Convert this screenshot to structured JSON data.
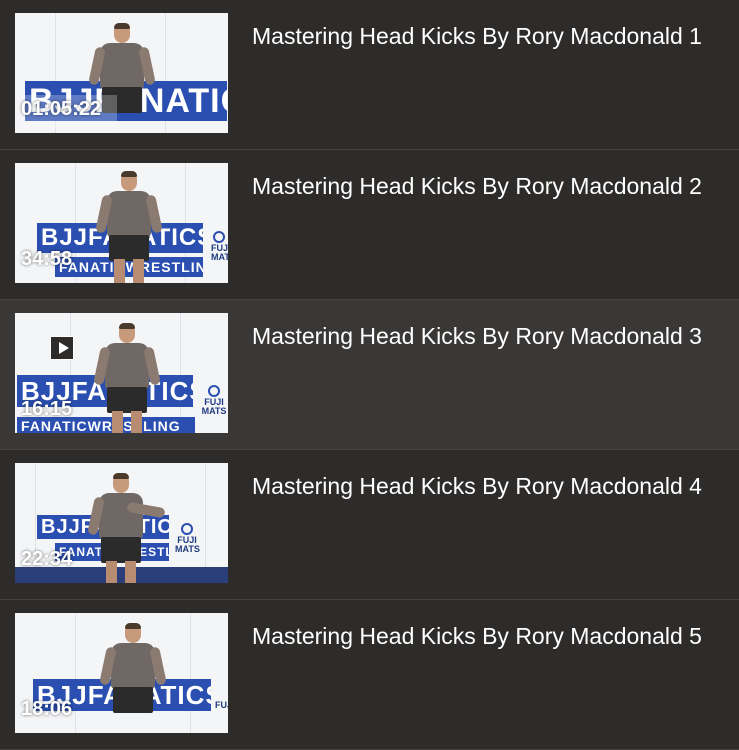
{
  "playlist": {
    "items": [
      {
        "title": "Mastering Head Kicks By Rory Macdonald 1",
        "duration": "01:05:22",
        "banner": "BJJFANATICS",
        "active": false,
        "playing": false
      },
      {
        "title": "Mastering Head Kicks By Rory Macdonald 2",
        "duration": "34:58",
        "banner": "BJJFANATICS",
        "banner2": "FANATICWRESTLING",
        "fuji": "FUJI MATS",
        "active": false,
        "playing": false
      },
      {
        "title": "Mastering Head Kicks By Rory Macdonald 3",
        "duration": "16:15",
        "banner": "BJJFANATICS",
        "banner2": "FANATICWRESTLING",
        "fuji": "FUJI MATS",
        "active": true,
        "playing": true
      },
      {
        "title": "Mastering Head Kicks By Rory Macdonald 4",
        "duration": "22:34",
        "banner": "BJJFANATICS",
        "banner2": "FANATICWRESTLING",
        "fuji": "FUJI MATS",
        "active": false,
        "playing": false
      },
      {
        "title": "Mastering Head Kicks By Rory Macdonald 5",
        "duration": "18:06",
        "banner": "BJJFANATICS",
        "fuji": "FUJI",
        "active": false,
        "playing": false
      }
    ]
  },
  "colors": {
    "background": "#2e2c2b",
    "active_row": "#3a3837",
    "banner_blue": "#2a4fb0",
    "text": "#ffffff"
  },
  "icons": {
    "now_playing": "play-icon"
  }
}
